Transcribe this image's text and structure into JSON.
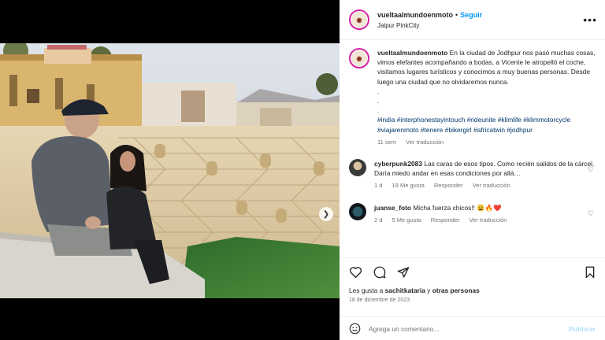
{
  "post": {
    "username": "vueltaalmundoenmoto",
    "follow_label": "Seguir",
    "location": "Jaipur PinkCity",
    "more_icon": "more-horizontal-icon",
    "caption_text": "En la ciudad de Jodhpur nos pasó muchas cosas, vimos elefantes acompañando a bodas, a Vicente le atropelló el coche, visitamos lugares turísticos y conocimos a muy buenas personas. Desde luego una ciudad que no olvidaremos nunca.",
    "caption_dots": ".",
    "hashtags": "#india #interphonestayintouch #rideunite #klimlife #klimmotorcycle #viajarenmoto #tenere #bikergirl #africatwin #jodhpur",
    "time_ago": "11 sem",
    "see_translation": "Ver traducción",
    "likes_prefix": "Les gusta a ",
    "likes_user": "sachitkataria",
    "likes_middle": " y ",
    "likes_others": "otras personas",
    "date": "18 de diciembre de 2023"
  },
  "comments": [
    {
      "username": "cyberpunk2083",
      "text": "Las caras de esos tipos. Como recién salidos de la cárcel. Daría miedo andar en esas condiciones por allá…",
      "time": "1 d",
      "likes": "18 Me gusta",
      "reply": "Responder",
      "translate": "Ver traducción"
    },
    {
      "username": "juanse_foto",
      "text": "Micha fuerza chicos!! 😩🔥❤️",
      "time": "2 d",
      "likes": "5 Me gusta",
      "reply": "Responder",
      "translate": "Ver traducción"
    }
  ],
  "composer": {
    "placeholder": "Agrega un comentario...",
    "publish_label": "Publicar",
    "emoji_icon": "smiley-icon"
  },
  "colors": {
    "link_blue": "#0095f6",
    "hashtag_blue": "#00376b",
    "muted": "#737373",
    "publish_disabled": "#b2dffc"
  }
}
